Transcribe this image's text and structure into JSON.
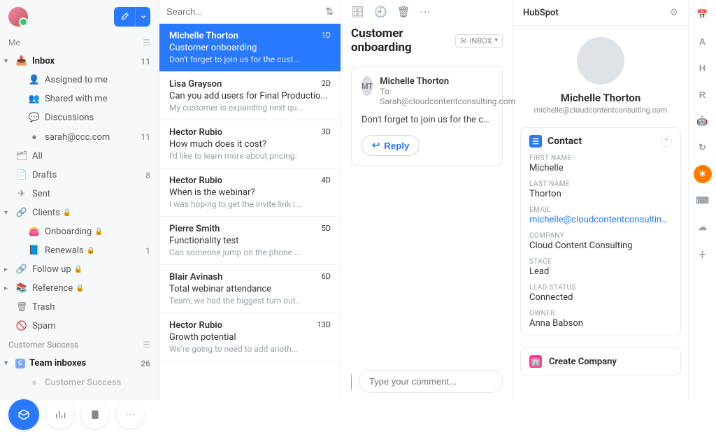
{
  "sidebar": {
    "me_label": "Me",
    "customer_success_label": "Customer Success",
    "folders": [
      {
        "icon": "📥",
        "label": "Inbox",
        "count": "11",
        "bold": true,
        "chev": "▾"
      },
      {
        "icon": "👤",
        "label": "Assigned to me",
        "nested": true
      },
      {
        "icon": "👥",
        "label": "Shared with me",
        "nested": true
      },
      {
        "icon": "💬",
        "label": "Discussions",
        "nested": true
      },
      {
        "icon": "●",
        "label": "sarah@ccc.com",
        "count": "11",
        "nested": true
      },
      {
        "icon": "🗂",
        "label": "All"
      },
      {
        "icon": "📄",
        "label": "Drafts",
        "count": "8"
      },
      {
        "icon": "✈",
        "label": "Sent"
      },
      {
        "icon": "🔗",
        "label": "Clients",
        "lock": true,
        "chev": "▾"
      },
      {
        "icon": "👛",
        "label": "Onboarding",
        "lock": true,
        "nested": true
      },
      {
        "icon": "📘",
        "label": "Renewals",
        "count": "1",
        "lock": true,
        "nested": true
      },
      {
        "icon": "🔗",
        "label": "Follow up",
        "lock": true,
        "chev": "▸"
      },
      {
        "icon": "📚",
        "label": "Reference",
        "lock": true,
        "chev": "▸"
      },
      {
        "icon": "🗑",
        "label": "Trash"
      },
      {
        "icon": "🚫",
        "label": "Spam"
      }
    ],
    "team_inboxes": {
      "label": "Team inboxes",
      "count": "26"
    },
    "cs_child": "Customer Success"
  },
  "search": {
    "placeholder": "Search..."
  },
  "threads": [
    {
      "from": "Michelle Thorton",
      "time": "1D",
      "subject": "Customer onboarding",
      "preview": "Don't forget to join us for the cust...",
      "active": true
    },
    {
      "from": "Lisa Grayson",
      "time": "2D",
      "subject": "Can you add users for Final Productio...",
      "preview": "My customer is expanding next qu..."
    },
    {
      "from": "Hector Rubio",
      "time": "3D",
      "subject": "How much does it cost?",
      "preview": "I'd like to learn more about pricing."
    },
    {
      "from": "Hector Rubio",
      "time": "4D",
      "subject": "When is the webinar?",
      "preview": "I was hoping to get the invite link i..."
    },
    {
      "from": "Pierre Smith",
      "time": "5D",
      "subject": "Functionality test",
      "preview": "Can someone jump on the phone ..."
    },
    {
      "from": "Blair Avinash",
      "time": "6D",
      "subject": "Total webinar attendance",
      "preview": "Team, we had the biggest turn out..."
    },
    {
      "from": "Hector Rubio",
      "time": "13D",
      "subject": "Growth potential",
      "preview": "We're going to need to add anoth..."
    }
  ],
  "reading": {
    "subject": "Customer onboarding",
    "inbox_badge": "INBOX",
    "from": "Michelle Thorton",
    "initials": "MT",
    "to": "To: Sarah@cloudcontentconsulting.com",
    "body": "Don't forget to join us for the customer…",
    "reply": "Reply",
    "comment_placeholder": "Type your comment..."
  },
  "hubspot": {
    "title": "HubSpot",
    "name": "Michelle Thorton",
    "email": "michelle@cloudcontentconsulting.com",
    "contact_card_title": "Contact",
    "fields": {
      "first_name_label": "FIRST NAME",
      "first_name": "Michelle",
      "last_name_label": "LAST NAME",
      "last_name": "Thorton",
      "email_label": "EMAIL",
      "email_val": "michelle@cloudcontentconsulting....",
      "company_label": "COMPANY",
      "company": "Cloud Content Consulting",
      "stage_label": "STAGE",
      "stage": "Lead",
      "lead_status_label": "LEAD STATUS",
      "lead_status": "Connected",
      "owner_label": "OWNER",
      "owner": "Anna Babson"
    },
    "create_company": "Create Company"
  },
  "rail": [
    "📅",
    "A",
    "H",
    "R",
    "🤖",
    "↻",
    "✶",
    "⌨",
    "☁",
    "＋"
  ]
}
